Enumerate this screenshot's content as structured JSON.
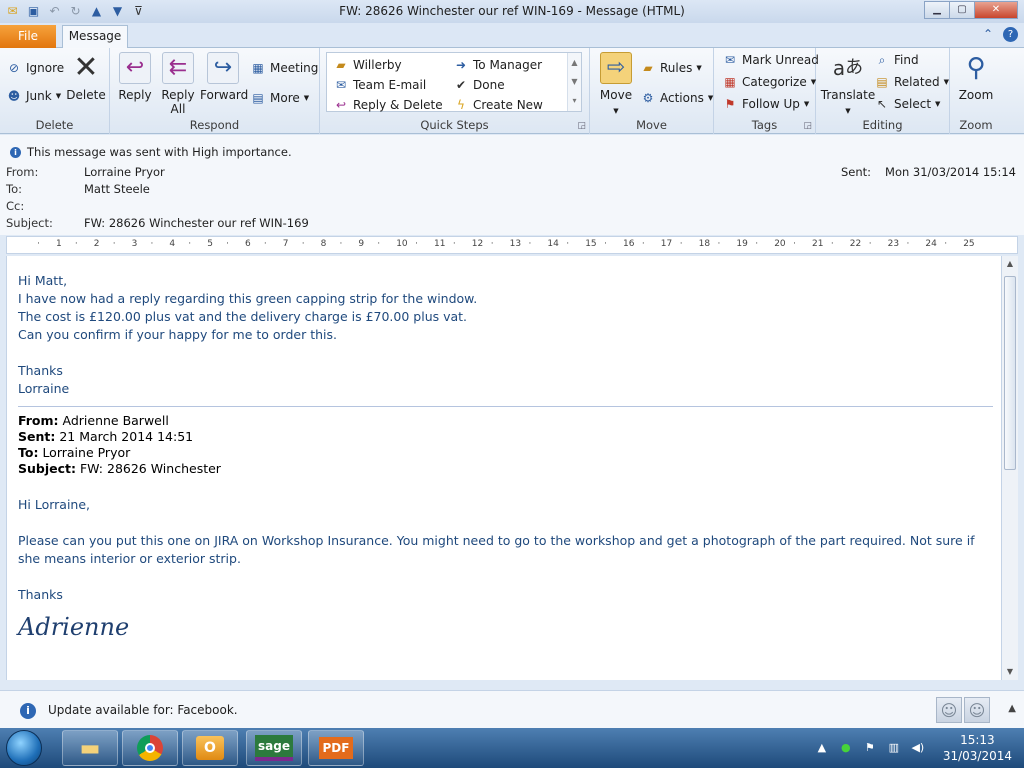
{
  "window": {
    "title": "FW: 28626 Winchester  our ref WIN-169  -  Message (HTML)",
    "controls": {
      "minimize": "▁",
      "maximize": "▢",
      "close": "✕"
    }
  },
  "tabs": {
    "file": "File",
    "message": "Message"
  },
  "ribbon": {
    "delete_group": {
      "label": "Delete",
      "ignore": "Ignore",
      "junk": "Junk",
      "delete": "Delete"
    },
    "respond_group": {
      "label": "Respond",
      "reply": "Reply",
      "reply_all_line1": "Reply",
      "reply_all_line2": "All",
      "forward": "Forward",
      "meeting": "Meeting",
      "more": "More"
    },
    "quick_steps": {
      "label": "Quick Steps",
      "items": [
        "Willerby",
        "To Manager",
        "Team E-mail",
        "Done",
        "Reply & Delete",
        "Create New"
      ]
    },
    "move_group": {
      "label": "Move",
      "move": "Move",
      "rules": "Rules",
      "actions": "Actions"
    },
    "tags_group": {
      "label": "Tags",
      "mark_unread": "Mark Unread",
      "categorize": "Categorize",
      "follow_up": "Follow Up"
    },
    "editing_group": {
      "label": "Editing",
      "translate": "Translate",
      "find": "Find",
      "related": "Related",
      "select": "Select"
    },
    "zoom_group": {
      "label": "Zoom",
      "zoom": "Zoom"
    }
  },
  "header": {
    "importance": "This message was sent with High importance.",
    "from_label": "From:",
    "from": "Lorraine Pryor",
    "to_label": "To:",
    "to": "Matt Steele",
    "cc_label": "Cc:",
    "cc": "",
    "subject_label": "Subject:",
    "subject": "FW: 28626 Winchester  our ref WIN-169",
    "sent_label": "Sent:",
    "sent": "Mon 31/03/2014 15:14"
  },
  "ruler": {
    "ticks": [
      "1",
      "2",
      "3",
      "4",
      "5",
      "6",
      "7",
      "8",
      "9",
      "10",
      "11",
      "12",
      "13",
      "14",
      "15",
      "16",
      "17",
      "18",
      "19",
      "20",
      "21",
      "22",
      "23",
      "24",
      "25"
    ]
  },
  "message": {
    "greeting": "Hi Matt,",
    "line1": "I have now had a reply regarding this green capping strip for the window.",
    "line2": "The cost is £120.00 plus vat and the delivery charge is £70.00 plus vat.",
    "line3": "Can you confirm if your happy for me to order this.",
    "thanks": "Thanks",
    "signoff": "Lorraine",
    "forwarded": {
      "from_label": "From:",
      "from": "Adrienne Barwell",
      "sent_label": "Sent:",
      "sent": "21 March 2014 14:51",
      "to_label": "To:",
      "to": "Lorraine Pryor",
      "subject_label": "Subject:",
      "subject": "FW: 28626 Winchester",
      "greeting": "Hi Lorraine,",
      "body": "Please can you put this one on JIRA on Workshop Insurance.  You might need to go to the workshop and get a photograph of the part required.  Not sure if she means interior or exterior strip.",
      "thanks": "Thanks",
      "signature": "Adrienne"
    }
  },
  "people_pane": {
    "update_text": "Update available for: Facebook."
  },
  "taskbar": {
    "items": [
      "explorer",
      "chrome",
      "outlook",
      "sage",
      "PDF"
    ],
    "sage_label": "sage",
    "pdf_label": "PDF",
    "time": "15:13",
    "date": "31/03/2014"
  },
  "colors": {
    "body_text": "#1f497d",
    "file_tab": "#e2760e",
    "accent": "#2e67b4"
  }
}
